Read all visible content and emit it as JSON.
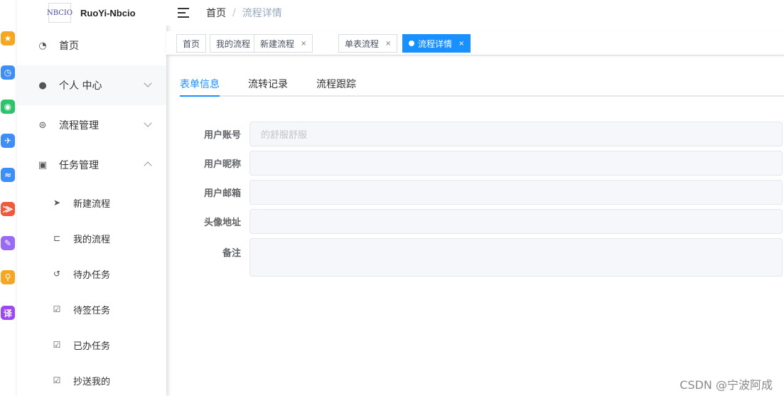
{
  "app": {
    "logo_text": "NBCIO",
    "title": "RuoYi-Nbcio"
  },
  "dock": [
    {
      "icon": "star-icon",
      "glyph": "★",
      "color": "#f5a623"
    },
    {
      "icon": "clock-icon",
      "glyph": "◷",
      "color": "#3d8ef7"
    },
    {
      "icon": "wechat-icon",
      "glyph": "◉",
      "color": "#2dc36a"
    },
    {
      "icon": "plane-icon",
      "glyph": "✈",
      "color": "#3d8ef7"
    },
    {
      "icon": "wave-icon",
      "glyph": "≈",
      "color": "#3d8ef7"
    },
    {
      "icon": "pdf-icon",
      "glyph": "⨠",
      "color": "#f05a3c"
    },
    {
      "icon": "pen-icon",
      "glyph": "✎",
      "color": "#9a6af5"
    },
    {
      "icon": "search-icon",
      "glyph": "⚲",
      "color": "#f5a623"
    },
    {
      "icon": "translate-icon",
      "glyph": "译",
      "color": "#9a4af0"
    }
  ],
  "sidebar": {
    "menu": [
      {
        "label": "首页",
        "icon": "dashboard-icon",
        "glyph": "◔"
      },
      {
        "label": "个人 中心",
        "icon": "user-icon",
        "glyph": "●",
        "arrow": "down"
      },
      {
        "label": "流程管理",
        "icon": "flow-icon",
        "glyph": "⊜",
        "arrow": "down"
      },
      {
        "label": "任务管理",
        "icon": "task-icon",
        "glyph": "▣",
        "arrow": "up"
      }
    ],
    "sub": [
      {
        "label": "新建流程",
        "icon": "send-icon",
        "glyph": "➤"
      },
      {
        "label": "我的流程",
        "icon": "tree-icon",
        "glyph": "⊏"
      },
      {
        "label": "待办任务",
        "icon": "history-icon",
        "glyph": "↺"
      },
      {
        "label": "待签任务",
        "icon": "checkbox-icon",
        "glyph": "☑"
      },
      {
        "label": "已办任务",
        "icon": "checkbox-icon",
        "glyph": "☑"
      },
      {
        "label": "抄送我的",
        "icon": "checkbox-icon",
        "glyph": "☑"
      }
    ]
  },
  "breadcrumb": {
    "home": "首页",
    "separator": "/",
    "current": "流程详情"
  },
  "tags": [
    {
      "label": "首页",
      "closable": false,
      "active": false
    },
    {
      "label": "我的流程",
      "closable": true,
      "active": false
    },
    {
      "label": "新建流程",
      "closable": true,
      "active": false
    },
    {
      "label": "单表流程",
      "closable": true,
      "active": false
    },
    {
      "label": "流程详情",
      "closable": true,
      "active": true
    }
  ],
  "tag_close_glyph": "×",
  "tabs": [
    {
      "label": "表单信息",
      "active": true
    },
    {
      "label": "流转记录",
      "active": false
    },
    {
      "label": "流程跟踪",
      "active": false
    }
  ],
  "form": [
    {
      "label": "用户账号",
      "value": "的舒服舒服"
    },
    {
      "label": "用户昵称",
      "value": ""
    },
    {
      "label": "用户邮箱",
      "value": ""
    },
    {
      "label": "头像地址",
      "value": ""
    },
    {
      "label": "备注",
      "value": "",
      "multiline": true
    }
  ],
  "watermark": "CSDN @宁波阿成",
  "colors": {
    "primary": "#1890ff",
    "active_tag": "#42b983"
  }
}
